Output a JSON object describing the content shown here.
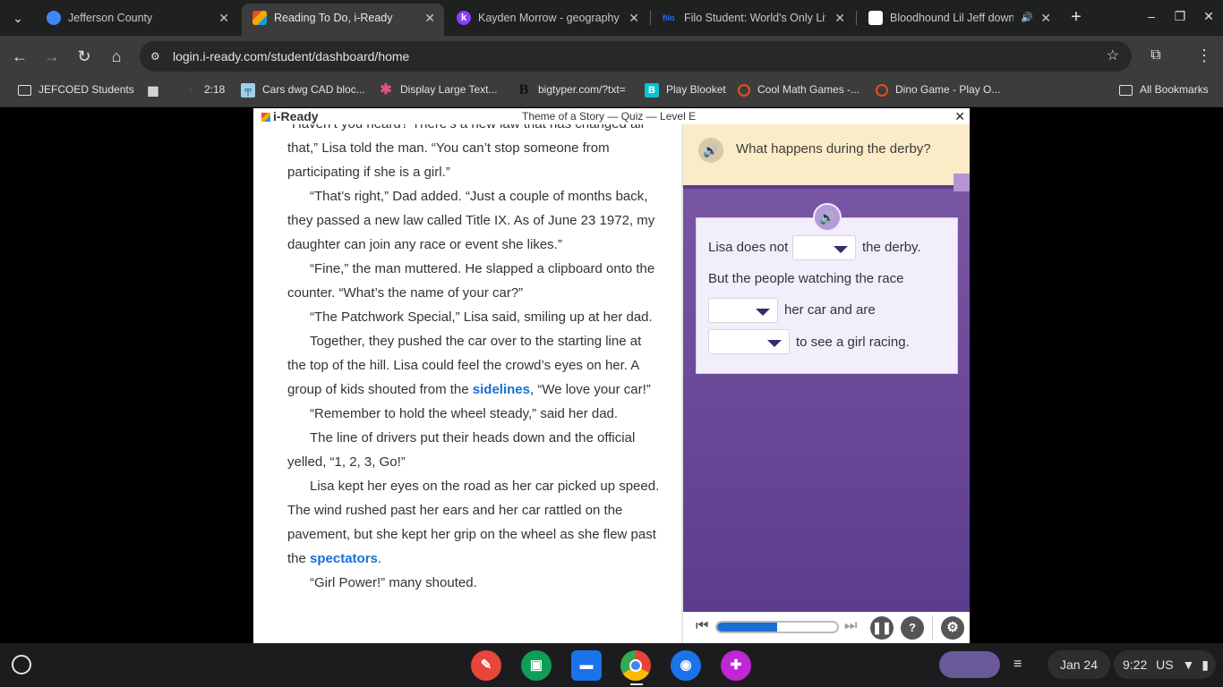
{
  "browser": {
    "tabs": [
      {
        "title": "Jefferson County",
        "favicon_color": "#4285f4"
      },
      {
        "title": "Reading To Do, i-Ready",
        "favicon_color": "#f6a800"
      },
      {
        "title": "Kayden Morrow - geography c",
        "favicon_color": "#8a3ffc"
      },
      {
        "title": "Filo Student: World's Only Liv",
        "favicon_color": "#2b6bff",
        "favicon_text": "filo"
      },
      {
        "title": "Bloodhound Lil Jeff down",
        "favicon_color": "#ffffff"
      }
    ],
    "url": "login.i-ready.com/student/dashboard/home",
    "bookmarks": [
      {
        "label": "JEFCOED Students",
        "icon": "folder-icon"
      },
      {
        "label": "",
        "icon": "apps-grid-icon"
      },
      {
        "label": "2:18",
        "icon": "clock-icon"
      },
      {
        "label": "Cars dwg CAD bloc...",
        "icon": "cad-icon"
      },
      {
        "label": "Display Large Text...",
        "icon": "asterisk-icon"
      },
      {
        "label": "bigtyper.com/?txt=",
        "icon": "b-icon"
      },
      {
        "label": "Play Blooket",
        "icon": "blooket-icon"
      },
      {
        "label": "Cool Math Games -...",
        "icon": "target-icon"
      },
      {
        "label": "Dino Game - Play O...",
        "icon": "target-icon"
      },
      {
        "label": "All Bookmarks",
        "icon": "folder-icon"
      }
    ]
  },
  "iready": {
    "logo": "i-Ready",
    "title": "Theme of a Story — Quiz — Level E",
    "close": "✕",
    "passage": [
      {
        "text": "“Haven’t you heard? There’s a new law that has changed all that,” Lisa told the man. “You can’t stop someone from participating if she is a girl.”",
        "indent": false
      },
      {
        "text": "“That’s right,” Dad added. “Just a couple of months back, they passed a new law called Title IX.  As of June 23 1972, my daughter can join any race or event she likes.”",
        "indent": true
      },
      {
        "text": "“Fine,” the man muttered. He slapped a clipboard onto the counter. “What’s the name of your car?”",
        "indent": true
      },
      {
        "text": "“The Patchwork Special,” Lisa said, smiling up at her dad.",
        "indent": true
      },
      {
        "before": "Together, they pushed the car over to the starting line at the top of the hill. Lisa could feel the crowd’s eyes on her. A group of kids shouted from the ",
        "vocab": "sidelines",
        "after": ", “We love your car!”",
        "indent": true
      },
      {
        "text": "“Remember to hold the wheel steady,” said her dad.",
        "indent": true
      },
      {
        "text": "The line of drivers put their heads down and the official yelled, “1, 2, 3, Go!”",
        "indent": true
      },
      {
        "before": "Lisa kept her eyes on the road as her car picked up speed. The wind rushed past her ears and her car rattled on the pavement, but she kept her grip on the wheel as she flew past the ",
        "vocab": "spectators",
        "after": ".",
        "indent": true
      },
      {
        "text": "“Girl Power!” many shouted.",
        "indent": true
      }
    ],
    "question": "What happens during the derby?",
    "answer": {
      "line1_before": "Lisa does not",
      "line1_after": "the derby.",
      "line2": "But the people watching the race",
      "line3_after": "her car and are",
      "line4_after": "to see a girl racing."
    },
    "player": {
      "progress": 0.5,
      "help": "?"
    }
  },
  "shelf": {
    "date": "Jan 24",
    "time": "9:22",
    "locale": "US"
  },
  "colors": {
    "vocab": "#1a6fd4",
    "panel_top": "#7c5aa8",
    "panel_bottom": "#5c3c8c",
    "banner": "#fbebc6"
  }
}
